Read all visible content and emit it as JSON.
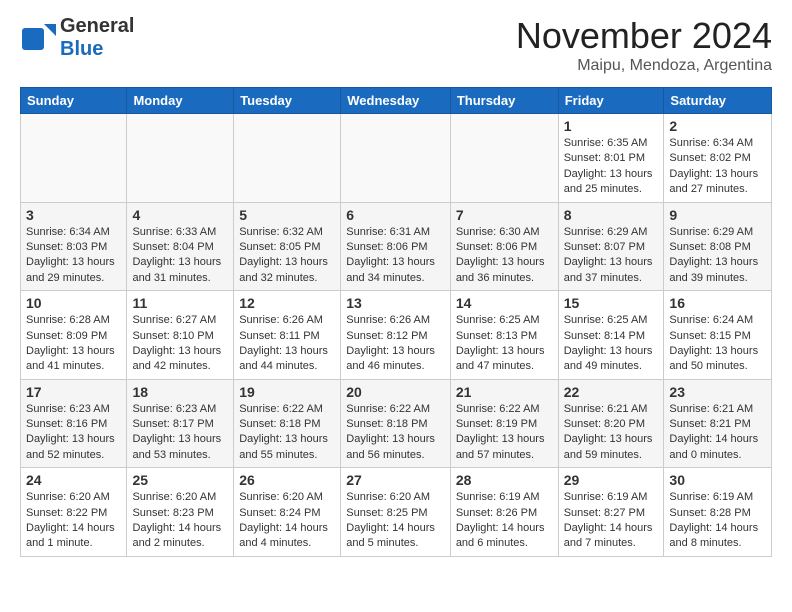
{
  "header": {
    "logo_general": "General",
    "logo_blue": "Blue",
    "month_title": "November 2024",
    "location": "Maipu, Mendoza, Argentina"
  },
  "days_of_week": [
    "Sunday",
    "Monday",
    "Tuesday",
    "Wednesday",
    "Thursday",
    "Friday",
    "Saturday"
  ],
  "weeks": [
    [
      {
        "day": "",
        "info": ""
      },
      {
        "day": "",
        "info": ""
      },
      {
        "day": "",
        "info": ""
      },
      {
        "day": "",
        "info": ""
      },
      {
        "day": "",
        "info": ""
      },
      {
        "day": "1",
        "info": "Sunrise: 6:35 AM\nSunset: 8:01 PM\nDaylight: 13 hours and 25 minutes."
      },
      {
        "day": "2",
        "info": "Sunrise: 6:34 AM\nSunset: 8:02 PM\nDaylight: 13 hours and 27 minutes."
      }
    ],
    [
      {
        "day": "3",
        "info": "Sunrise: 6:34 AM\nSunset: 8:03 PM\nDaylight: 13 hours and 29 minutes."
      },
      {
        "day": "4",
        "info": "Sunrise: 6:33 AM\nSunset: 8:04 PM\nDaylight: 13 hours and 31 minutes."
      },
      {
        "day": "5",
        "info": "Sunrise: 6:32 AM\nSunset: 8:05 PM\nDaylight: 13 hours and 32 minutes."
      },
      {
        "day": "6",
        "info": "Sunrise: 6:31 AM\nSunset: 8:06 PM\nDaylight: 13 hours and 34 minutes."
      },
      {
        "day": "7",
        "info": "Sunrise: 6:30 AM\nSunset: 8:06 PM\nDaylight: 13 hours and 36 minutes."
      },
      {
        "day": "8",
        "info": "Sunrise: 6:29 AM\nSunset: 8:07 PM\nDaylight: 13 hours and 37 minutes."
      },
      {
        "day": "9",
        "info": "Sunrise: 6:29 AM\nSunset: 8:08 PM\nDaylight: 13 hours and 39 minutes."
      }
    ],
    [
      {
        "day": "10",
        "info": "Sunrise: 6:28 AM\nSunset: 8:09 PM\nDaylight: 13 hours and 41 minutes."
      },
      {
        "day": "11",
        "info": "Sunrise: 6:27 AM\nSunset: 8:10 PM\nDaylight: 13 hours and 42 minutes."
      },
      {
        "day": "12",
        "info": "Sunrise: 6:26 AM\nSunset: 8:11 PM\nDaylight: 13 hours and 44 minutes."
      },
      {
        "day": "13",
        "info": "Sunrise: 6:26 AM\nSunset: 8:12 PM\nDaylight: 13 hours and 46 minutes."
      },
      {
        "day": "14",
        "info": "Sunrise: 6:25 AM\nSunset: 8:13 PM\nDaylight: 13 hours and 47 minutes."
      },
      {
        "day": "15",
        "info": "Sunrise: 6:25 AM\nSunset: 8:14 PM\nDaylight: 13 hours and 49 minutes."
      },
      {
        "day": "16",
        "info": "Sunrise: 6:24 AM\nSunset: 8:15 PM\nDaylight: 13 hours and 50 minutes."
      }
    ],
    [
      {
        "day": "17",
        "info": "Sunrise: 6:23 AM\nSunset: 8:16 PM\nDaylight: 13 hours and 52 minutes."
      },
      {
        "day": "18",
        "info": "Sunrise: 6:23 AM\nSunset: 8:17 PM\nDaylight: 13 hours and 53 minutes."
      },
      {
        "day": "19",
        "info": "Sunrise: 6:22 AM\nSunset: 8:18 PM\nDaylight: 13 hours and 55 minutes."
      },
      {
        "day": "20",
        "info": "Sunrise: 6:22 AM\nSunset: 8:18 PM\nDaylight: 13 hours and 56 minutes."
      },
      {
        "day": "21",
        "info": "Sunrise: 6:22 AM\nSunset: 8:19 PM\nDaylight: 13 hours and 57 minutes."
      },
      {
        "day": "22",
        "info": "Sunrise: 6:21 AM\nSunset: 8:20 PM\nDaylight: 13 hours and 59 minutes."
      },
      {
        "day": "23",
        "info": "Sunrise: 6:21 AM\nSunset: 8:21 PM\nDaylight: 14 hours and 0 minutes."
      }
    ],
    [
      {
        "day": "24",
        "info": "Sunrise: 6:20 AM\nSunset: 8:22 PM\nDaylight: 14 hours and 1 minute."
      },
      {
        "day": "25",
        "info": "Sunrise: 6:20 AM\nSunset: 8:23 PM\nDaylight: 14 hours and 2 minutes."
      },
      {
        "day": "26",
        "info": "Sunrise: 6:20 AM\nSunset: 8:24 PM\nDaylight: 14 hours and 4 minutes."
      },
      {
        "day": "27",
        "info": "Sunrise: 6:20 AM\nSunset: 8:25 PM\nDaylight: 14 hours and 5 minutes."
      },
      {
        "day": "28",
        "info": "Sunrise: 6:19 AM\nSunset: 8:26 PM\nDaylight: 14 hours and 6 minutes."
      },
      {
        "day": "29",
        "info": "Sunrise: 6:19 AM\nSunset: 8:27 PM\nDaylight: 14 hours and 7 minutes."
      },
      {
        "day": "30",
        "info": "Sunrise: 6:19 AM\nSunset: 8:28 PM\nDaylight: 14 hours and 8 minutes."
      }
    ]
  ]
}
